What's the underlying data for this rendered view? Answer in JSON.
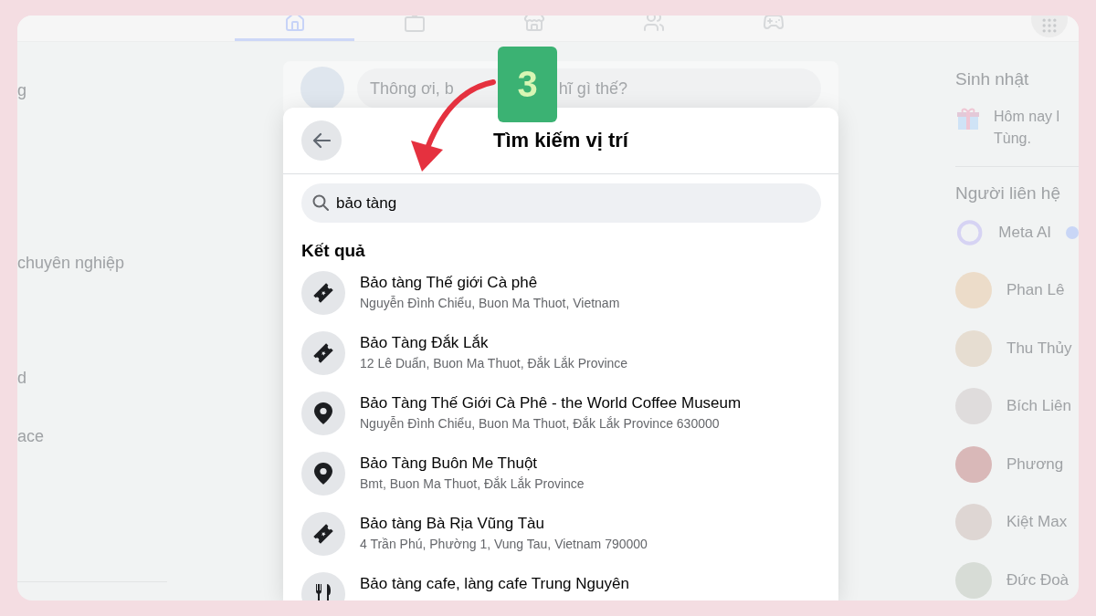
{
  "sidebar": {
    "items": [
      "g",
      "chuyên nghiệp",
      "d",
      "ace"
    ]
  },
  "composer": {
    "placeholder_parts": [
      "Thông ơi, b",
      "hĩ gì thế?"
    ]
  },
  "step_badge": "3",
  "dialog": {
    "title": "Tìm kiếm vị trí",
    "search": {
      "value": "bảo tàng"
    },
    "section_title": "Kết quả",
    "results": [
      {
        "kind": "ticket",
        "name": "Bảo tàng Thế giới Cà phê",
        "address": "Nguyễn Đình Chiểu, Buon Ma Thuot, Vietnam"
      },
      {
        "kind": "ticket",
        "name": "Bảo Tàng Đắk Lắk",
        "address": "12 Lê Duẩn, Buon Ma Thuot, Đắk Lắk Province"
      },
      {
        "kind": "pin",
        "name": "Bảo Tàng Thế Giới Cà Phê - the World Coffee Museum",
        "address": "Nguyễn Đình Chiểu, Buon Ma Thuot, Đắk Lắk Province 630000"
      },
      {
        "kind": "pin",
        "name": "Bảo Tàng Buôn Me Thuột",
        "address": "Bmt, Buon Ma Thuot, Đắk Lắk Province"
      },
      {
        "kind": "ticket",
        "name": "Bảo tàng Bà Rịa Vũng Tàu",
        "address": "4 Trần Phú, Phường 1, Vung Tau, Vietnam 790000"
      },
      {
        "kind": "food",
        "name": "Bảo tàng cafe, làng cafe Trung Nguyên"
      }
    ]
  },
  "birthdays": {
    "title": "Sinh nhật",
    "lines": [
      "Hôm nay l",
      "Tùng."
    ]
  },
  "contacts": {
    "title": "Người liên hệ",
    "items": [
      {
        "kind": "ai",
        "name": "Meta AI",
        "verified": true
      },
      {
        "kind": "person",
        "name": "Phan Lê",
        "verified": false
      },
      {
        "kind": "person",
        "name": "Thu Thủy",
        "verified": false
      },
      {
        "kind": "person",
        "name": "Bích Liên",
        "verified": false
      },
      {
        "kind": "person",
        "name": "Phương",
        "verified": false
      },
      {
        "kind": "person",
        "name": "Kiệt Max",
        "verified": false
      },
      {
        "kind": "person",
        "name": "Đức Đoà",
        "verified": false
      }
    ]
  }
}
